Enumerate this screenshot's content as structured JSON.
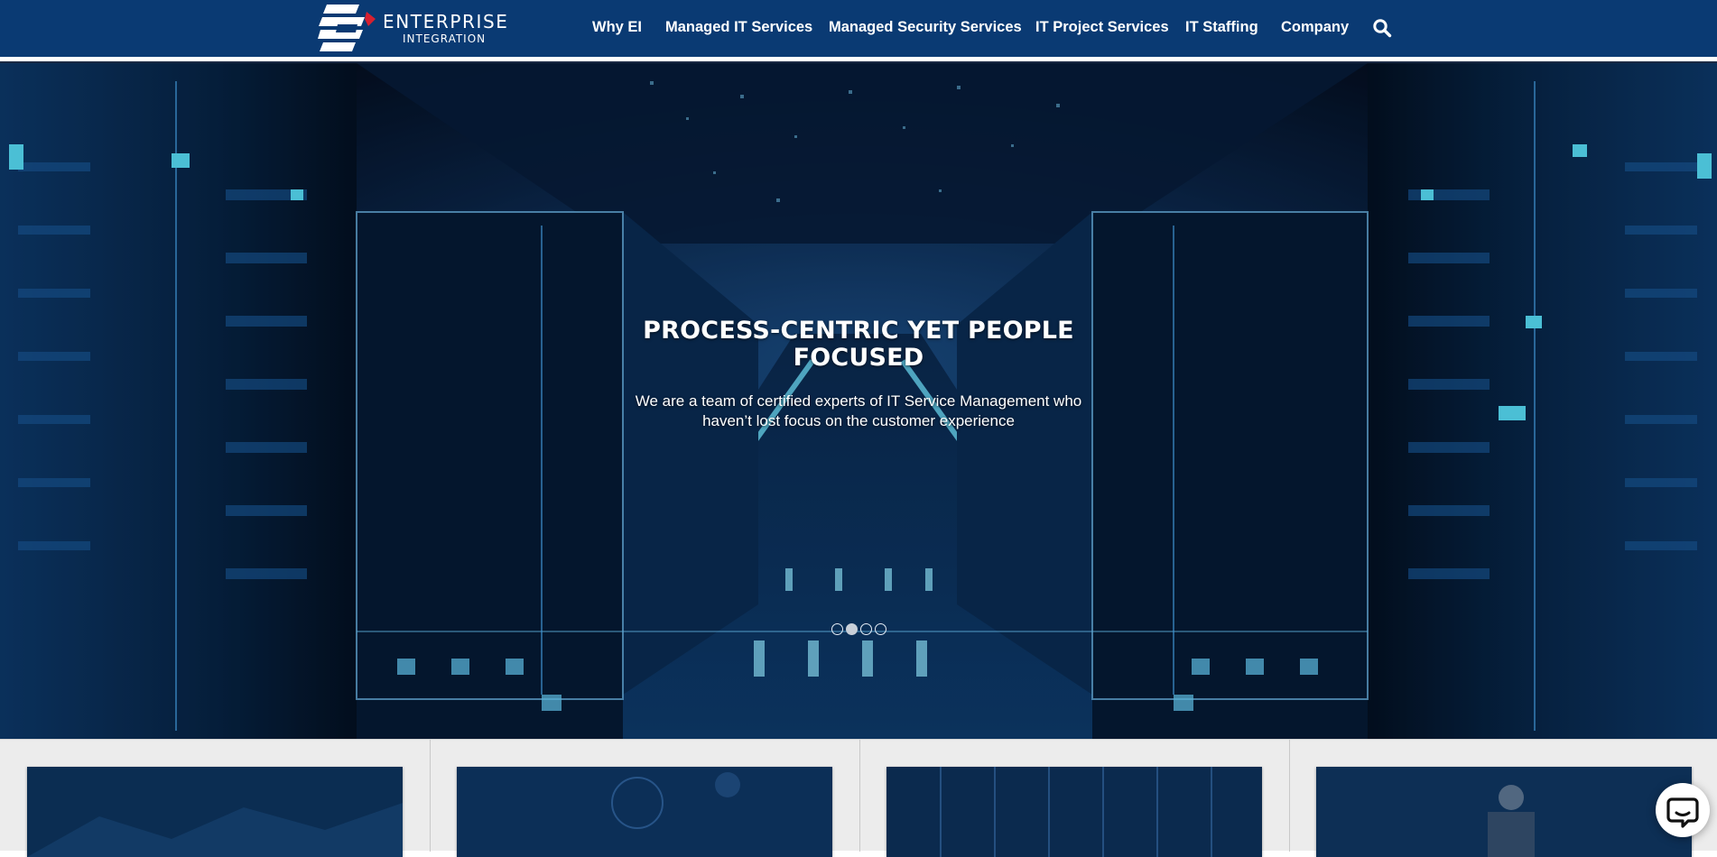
{
  "brand": {
    "name_line1": "ENTERPRISE",
    "name_line2": "INTEGRATION",
    "colors": {
      "navy": "#0a3a73",
      "accent_red": "#d62030",
      "white": "#ffffff"
    }
  },
  "nav": {
    "items": [
      {
        "label": "Why EI"
      },
      {
        "label": "Managed IT Services"
      },
      {
        "label": "Managed Security Services"
      },
      {
        "label": "IT Project Services"
      },
      {
        "label": "IT Staffing"
      },
      {
        "label": "Company"
      }
    ],
    "search_icon": "search-icon"
  },
  "hero": {
    "title": "PROCESS-CENTRIC YET PEOPLE FOCUSED",
    "subtitle": "We are a team of certified experts of IT Service Management who haven’t lost focus on the customer experience",
    "slides_total": 4,
    "active_slide": 2
  },
  "cards": {
    "count": 4
  },
  "chat": {
    "icon": "chat-bubble-icon"
  }
}
